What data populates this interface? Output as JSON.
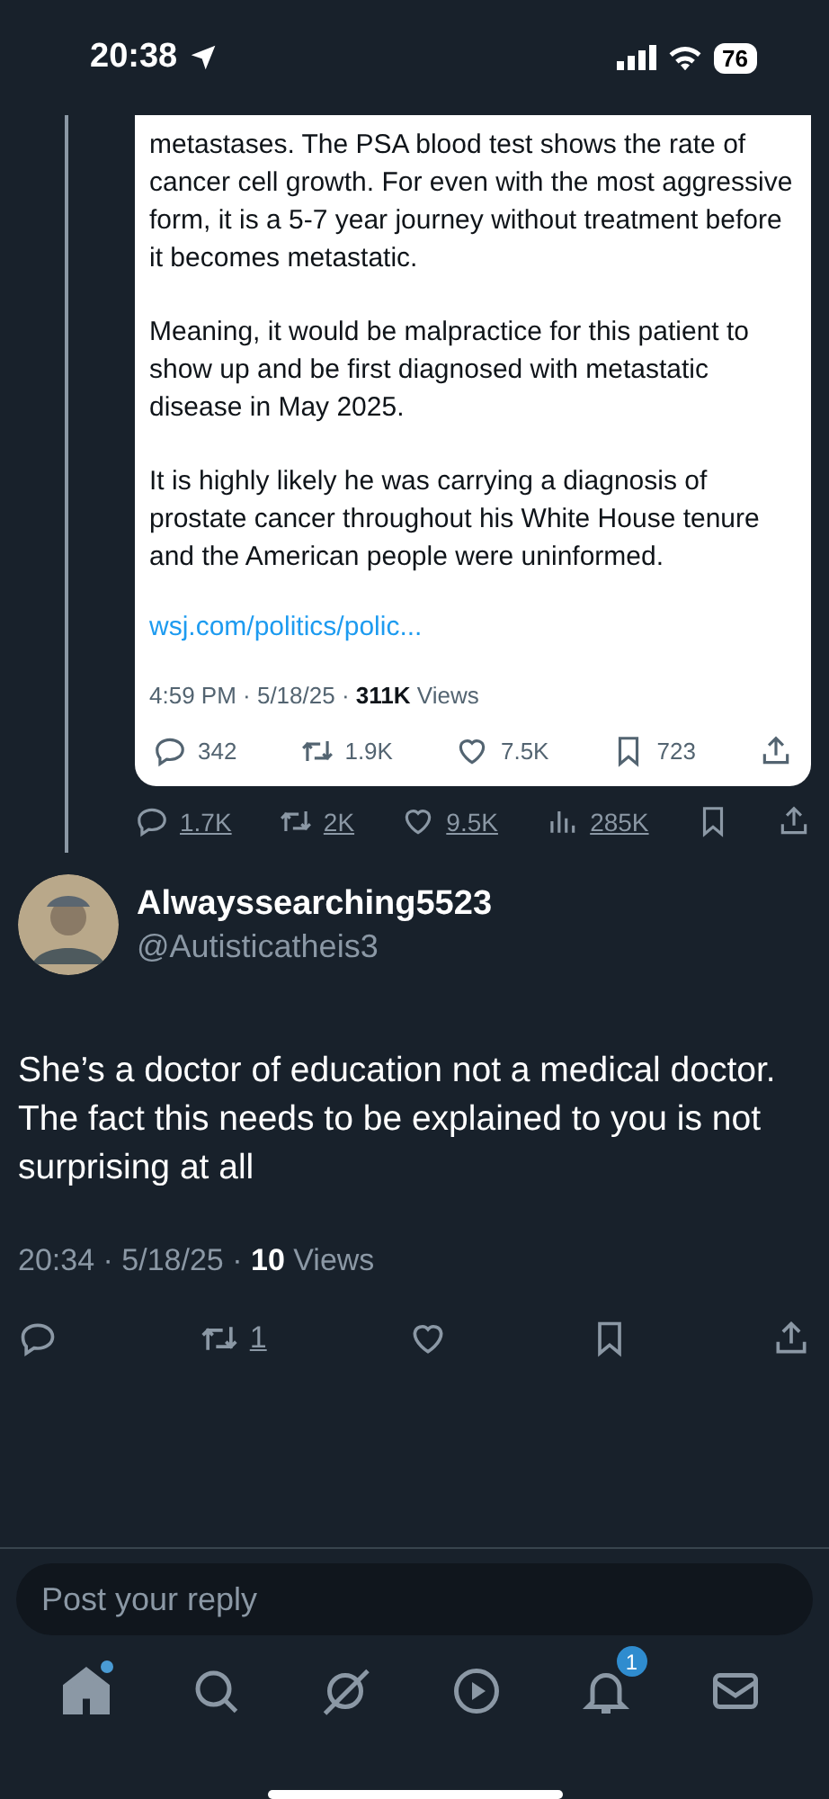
{
  "status_bar": {
    "time": "20:38",
    "battery": "76"
  },
  "quoted_card": {
    "paragraphs": [
      "metastases. The PSA blood test shows the rate of cancer cell growth. For even with the most aggressive form, it is a 5-7 year journey without treatment before it becomes metastatic.",
      "Meaning, it would be malpractice for this patient to show up and be first diagnosed with metastatic disease in May 2025.",
      "It is highly likely he was carrying a diagnosis of prostate cancer throughout his White House tenure and the American people were uninformed."
    ],
    "link": "wsj.com/politics/polic...",
    "meta": "4:59 PM · 5/18/25 · **311K** Views",
    "actions": [
      {
        "kind": "reply",
        "count": "342"
      },
      {
        "kind": "repost",
        "count": "1.9K"
      },
      {
        "kind": "like",
        "count": "7.5K"
      },
      {
        "kind": "bookmark",
        "count": "723"
      },
      {
        "kind": "share"
      }
    ]
  },
  "parent_actions": [
    {
      "kind": "reply",
      "count": "1.7K"
    },
    {
      "kind": "repost",
      "count": "2K"
    },
    {
      "kind": "like",
      "count": "9.5K"
    },
    {
      "kind": "views",
      "count": "285K"
    },
    {
      "kind": "bookmark"
    },
    {
      "kind": "share"
    }
  ],
  "reply": {
    "name": "Alwayssearching5523",
    "handle": "@Autisticatheis3",
    "text": "She’s a doctor of education not a medical doctor. The fact this needs to be explained to you is not surprising at all",
    "meta": "20:34 · 5/18/25 · **10** Views",
    "actions": [
      {
        "kind": "reply"
      },
      {
        "kind": "repost",
        "count": "1"
      },
      {
        "kind": "like"
      },
      {
        "kind": "bookmark"
      },
      {
        "kind": "share"
      }
    ]
  },
  "reply_box": {
    "placeholder": "Post your reply"
  },
  "nav": [
    {
      "kind": "home",
      "selected": true,
      "dot": true
    },
    {
      "kind": "search",
      "selected": false
    },
    {
      "kind": "grok",
      "selected": false
    },
    {
      "kind": "video",
      "selected": false
    },
    {
      "kind": "notifications",
      "selected": false,
      "badge": "1"
    },
    {
      "kind": "messages",
      "selected": false
    }
  ]
}
